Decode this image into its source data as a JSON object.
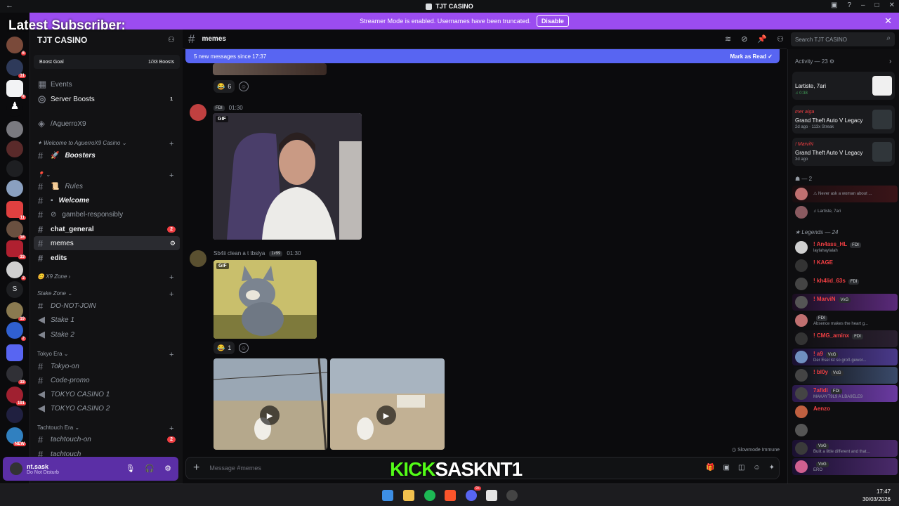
{
  "window": {
    "title": "TJT CASINO"
  },
  "overlay": {
    "subscriber": "Latest Subscriber:",
    "kick_green": "KICK",
    "kick_white": "SASKNT1"
  },
  "banner": {
    "text": "Streamer Mode is enabled. Usernames have been truncated.",
    "button": "Disable"
  },
  "server": {
    "name": "TJT CASINO"
  },
  "boost": {
    "label": "Boost Goal",
    "progress": "1/33 Boosts"
  },
  "sidebar": {
    "events": "Events",
    "server_boosts": "Server Boosts",
    "server_boosts_count": "1",
    "aguerro": "/AguerroX9",
    "cat_welcome": "Welcome to AguerroX9 Casino",
    "boosters": "Boosters",
    "rules": "Rules",
    "welcome": "Welcome",
    "gambel": "gambel-responsibly",
    "chat_general": "chat_general",
    "chat_general_count": "2",
    "memes": "memes",
    "edits": "edits",
    "cat_x9": "X9 Zone",
    "cat_stake": "Stake Zone",
    "do_not_join": "DO-NOT-JOIN",
    "stake1": "Stake 1",
    "stake2": "Stake 2",
    "cat_tokyo": "Tokyo Era",
    "tokyo_on": "Tokyo-on",
    "code_promo": "Code-promo",
    "tokyo_casino1": "TOKYO CASINO 1",
    "tokyo_casino2": "TOKYO CASINO 2",
    "cat_tachtouch": "Tachtouch Era",
    "tachtouch_on": "tachtouch-on",
    "tachtouch_on_count": "2",
    "tachtouch": "tachtouch"
  },
  "user": {
    "name": "nt.sask",
    "status": "Do Not Disturb"
  },
  "header": {
    "channel": "memes",
    "search_placeholder": "Search TJT CASINO"
  },
  "newbar": {
    "text": "5 new messages since 17:37",
    "action": "Mark as Read"
  },
  "messages": {
    "r1_count": "6",
    "m2_tag": "FDI",
    "m2_time": "01:30",
    "gif_label": "GIF",
    "m3_author": "Sb4ii clean a t tbslya",
    "m3_tag": "1v99",
    "m3_time": "01:30",
    "r3_count": "1",
    "slowmode": "Slowmode Immune"
  },
  "composer": {
    "placeholder": "Message #memes"
  },
  "activity": {
    "header": "Activity — 23",
    "card1": {
      "title": "Lartiste, 7ari",
      "sub": "0:38"
    },
    "card2": {
      "user": "mer aiga",
      "title": "Grand Theft Auto V Legacy",
      "sub": "2d ago · 113x Streak"
    },
    "card3": {
      "user": "! MarviN",
      "title": "Grand Theft Auto V Legacy",
      "sub": "3d ago"
    }
  },
  "members": {
    "group1": "— 2",
    "g1": [
      {
        "name": "",
        "status": "Never ask a woman about ..."
      },
      {
        "name": "",
        "status": "Lartiste, 7ari"
      }
    ],
    "group2": "Legends — 24",
    "g2": [
      {
        "name": "! An4ass_HL",
        "tag": "FDI",
        "status": "laylahaylalah"
      },
      {
        "name": "! KAGE",
        "tag": "",
        "status": ""
      },
      {
        "name": "! kh4lid_63s",
        "tag": "FDI",
        "status": ""
      },
      {
        "name": "! MarviN",
        "tag": "VxG",
        "status": ""
      },
      {
        "name": "",
        "tag": "FDI",
        "status": "Absence makes the heart g..."
      },
      {
        "name": "! CMG_aminx",
        "tag": "FDI",
        "status": ""
      },
      {
        "name": "! a9",
        "tag": "VxG",
        "status": "Der Esel ist so groß gewor..."
      },
      {
        "name": "! bl0y",
        "tag": "VxG",
        "status": ""
      },
      {
        "name": "7afidi",
        "tag": "FDI",
        "status": "MAKAYT9L9 A LBA9ELE9"
      },
      {
        "name": "Aenzo",
        "tag": "",
        "status": ""
      },
      {
        "name": "",
        "tag": "",
        "status": ""
      },
      {
        "name": "",
        "tag": "VxG",
        "status": "Built a little different and that..."
      },
      {
        "name": "",
        "tag": "VxG",
        "status": "ERO"
      }
    ]
  },
  "taskbar": {
    "time": "17:47",
    "date": "30/03/2026",
    "discord_badge": "9+"
  },
  "colors": {
    "accent": "#5865f2",
    "streamer": "#9b4cf0",
    "red": "#f23f43",
    "kick": "#53fc18"
  }
}
